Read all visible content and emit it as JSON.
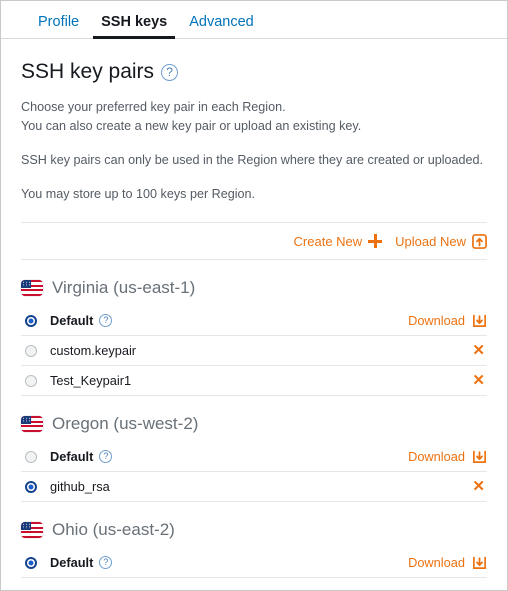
{
  "tabs": [
    {
      "label": "Profile",
      "active": false
    },
    {
      "label": "SSH keys",
      "active": true
    },
    {
      "label": "Advanced",
      "active": false
    }
  ],
  "header": {
    "title": "SSH key pairs",
    "help_icon": "help-circle-icon",
    "description_1": "Choose your preferred key pair in each Region.",
    "description_2": "You can also create a new key pair or upload an existing key.",
    "description_3": "SSH key pairs can only be used in the Region where they are created or uploaded.",
    "description_4": "You may store up to 100 keys per Region."
  },
  "actions": {
    "create_new": "Create New",
    "create_icon": "plus-icon",
    "upload_new": "Upload New",
    "upload_icon": "upload-box-icon"
  },
  "labels": {
    "download": "Download",
    "download_icon": "download-box-icon",
    "delete_icon": "close-x-icon",
    "flag_icon": "us-flag-icon"
  },
  "colors": {
    "accent_orange": "#ec7211",
    "link_blue": "#0073bb",
    "text_dark": "#16191f",
    "text_muted": "#545b64",
    "region_title": "#687078",
    "radio_selected": "#16438f",
    "divider": "#e4e6e8"
  },
  "regions": [
    {
      "name": "Virginia (us-east-1)",
      "keys": [
        {
          "name": "Default",
          "selected": true,
          "bold": true,
          "has_help": true,
          "action": "download"
        },
        {
          "name": "custom.keypair",
          "selected": false,
          "bold": false,
          "has_help": false,
          "action": "delete"
        },
        {
          "name": "Test_Keypair1",
          "selected": false,
          "bold": false,
          "has_help": false,
          "action": "delete"
        }
      ]
    },
    {
      "name": "Oregon (us-west-2)",
      "keys": [
        {
          "name": "Default",
          "selected": false,
          "bold": true,
          "has_help": true,
          "action": "download"
        },
        {
          "name": "github_rsa",
          "selected": true,
          "bold": false,
          "has_help": false,
          "action": "delete"
        }
      ]
    },
    {
      "name": "Ohio (us-east-2)",
      "keys": [
        {
          "name": "Default",
          "selected": true,
          "bold": true,
          "has_help": true,
          "action": "download"
        }
      ]
    }
  ]
}
